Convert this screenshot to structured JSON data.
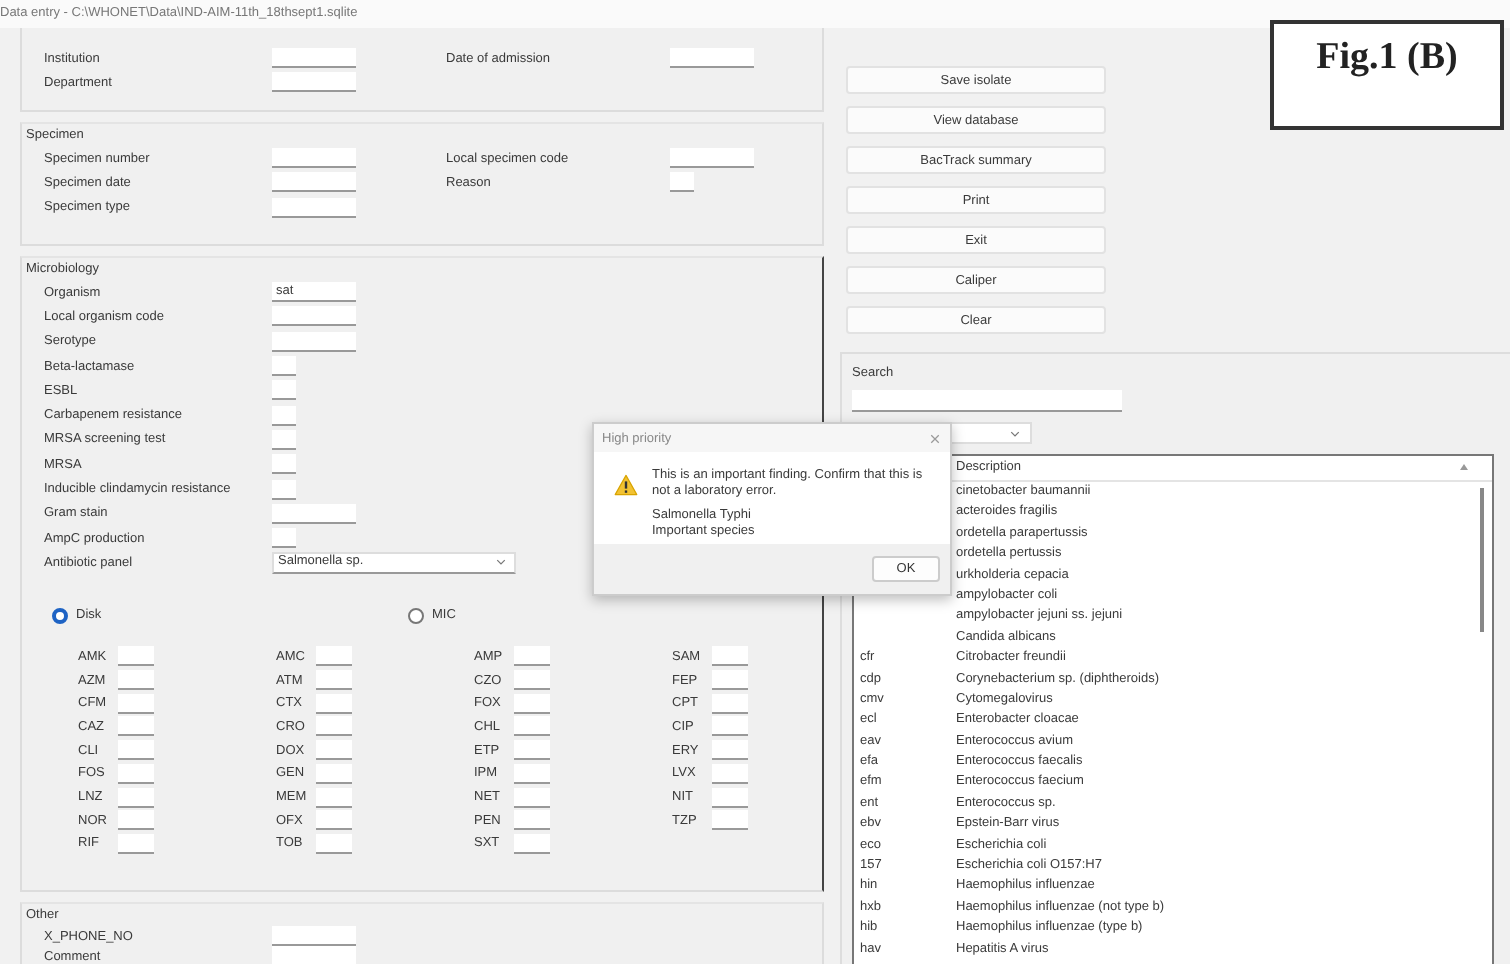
{
  "window": {
    "title": "Data entry - C:\\WHONET\\Data\\IND-AIM-11th_18thsept1.sqlite"
  },
  "figure_label": "Fig.1 (B)",
  "sections": [
    {
      "rows": [
        {
          "left": {
            "label": "Institution",
            "kind": "text"
          },
          "right": {
            "label": "Date of admission",
            "kind": "text"
          }
        },
        {
          "left": {
            "label": "Department",
            "kind": "text"
          }
        }
      ]
    },
    {
      "title": "Specimen",
      "rows": [
        {
          "left": {
            "label": "Specimen number",
            "kind": "text"
          },
          "right": {
            "label": "Local specimen code",
            "kind": "text"
          }
        },
        {
          "left": {
            "label": "Specimen date",
            "kind": "text"
          },
          "right": {
            "label": "Reason",
            "kind": "short"
          }
        },
        {
          "left": {
            "label": "Specimen type",
            "kind": "text"
          }
        }
      ]
    },
    {
      "title": "Microbiology",
      "rows": [
        {
          "left": {
            "label": "Organism",
            "kind": "text",
            "value": "sat"
          }
        },
        {
          "left": {
            "label": "Local organism code",
            "kind": "text"
          }
        },
        {
          "left": {
            "label": "Serotype",
            "kind": "text"
          }
        },
        {
          "left": {
            "label": "Beta-lactamase",
            "kind": "check"
          }
        },
        {
          "left": {
            "label": "ESBL",
            "kind": "check"
          }
        },
        {
          "left": {
            "label": "Carbapenem resistance",
            "kind": "check"
          }
        },
        {
          "left": {
            "label": "MRSA screening test",
            "kind": "check"
          }
        },
        {
          "left": {
            "label": "MRSA",
            "kind": "check"
          }
        },
        {
          "left": {
            "label": "Inducible clindamycin resistance",
            "kind": "check"
          }
        },
        {
          "left": {
            "label": "Gram stain",
            "kind": "text"
          }
        },
        {
          "left": {
            "label": "AmpC production",
            "kind": "check"
          }
        },
        {
          "left": {
            "label": "Antibiotic panel",
            "kind": "select",
            "value": "Salmonella sp."
          }
        }
      ],
      "methods": [
        {
          "label": "Disk",
          "selected": true
        },
        {
          "label": "MIC",
          "selected": false
        }
      ],
      "antibiotic_columns": [
        [
          "AMK",
          "AZM",
          "CFM",
          "CAZ",
          "CLI",
          "FOS",
          "LNZ",
          "NOR",
          "RIF"
        ],
        [
          "AMC",
          "ATM",
          "CTX",
          "CRO",
          "DOX",
          "GEN",
          "MEM",
          "OFX",
          "TOB"
        ],
        [
          "AMP",
          "CZO",
          "FOX",
          "CHL",
          "ETP",
          "IPM",
          "NET",
          "PEN",
          "SXT"
        ],
        [
          "SAM",
          "FEP",
          "CPT",
          "CIP",
          "ERY",
          "LVX",
          "NIT",
          "TZP"
        ]
      ]
    },
    {
      "title": "Other",
      "rows": [
        {
          "left": {
            "label": "X_PHONE_NO",
            "kind": "text"
          }
        },
        {
          "left": {
            "label": "Comment",
            "kind": "text"
          }
        }
      ]
    }
  ],
  "buttons": [
    "Save isolate",
    "View database",
    "BacTrack summary",
    "Print",
    "Exit",
    "Caliper",
    "Clear"
  ],
  "search": {
    "label": "Search"
  },
  "organism_table": {
    "columns": [
      "Description"
    ],
    "rows": [
      {
        "description": "cinetobacter baumannii"
      },
      {
        "description": "acteroides fragilis"
      },
      {
        "description": "ordetella parapertussis"
      },
      {
        "description": "ordetella pertussis"
      },
      {
        "description": "urkholderia cepacia"
      },
      {
        "description": "ampylobacter coli"
      },
      {
        "description": "ampylobacter jejuni ss. jejuni"
      },
      {
        "description": "Candida albicans"
      },
      {
        "code": "cfr",
        "description": "Citrobacter freundii"
      },
      {
        "code": "cdp",
        "description": "Corynebacterium sp. (diphtheroids)"
      },
      {
        "code": "cmv",
        "description": "Cytomegalovirus"
      },
      {
        "code": "ecl",
        "description": "Enterobacter cloacae"
      },
      {
        "code": "eav",
        "description": "Enterococcus avium"
      },
      {
        "code": "efa",
        "description": "Enterococcus faecalis"
      },
      {
        "code": "efm",
        "description": "Enterococcus faecium"
      },
      {
        "code": "ent",
        "description": "Enterococcus sp."
      },
      {
        "code": "ebv",
        "description": "Epstein-Barr virus"
      },
      {
        "code": "eco",
        "description": "Escherichia coli"
      },
      {
        "code": "157",
        "description": "Escherichia coli O157:H7"
      },
      {
        "code": "hin",
        "description": "Haemophilus influenzae"
      },
      {
        "code": "hxb",
        "description": "Haemophilus influenzae (not type b)"
      },
      {
        "code": "hib",
        "description": "Haemophilus influenzae (type b)"
      },
      {
        "code": "hav",
        "description": "Hepatitis A virus"
      }
    ]
  },
  "dialog": {
    "title": "High priority",
    "message": "This is an important finding.  Confirm that this is not a laboratory error.",
    "details": [
      "Salmonella Typhi",
      "Important species"
    ],
    "buttons": [
      "OK"
    ]
  }
}
